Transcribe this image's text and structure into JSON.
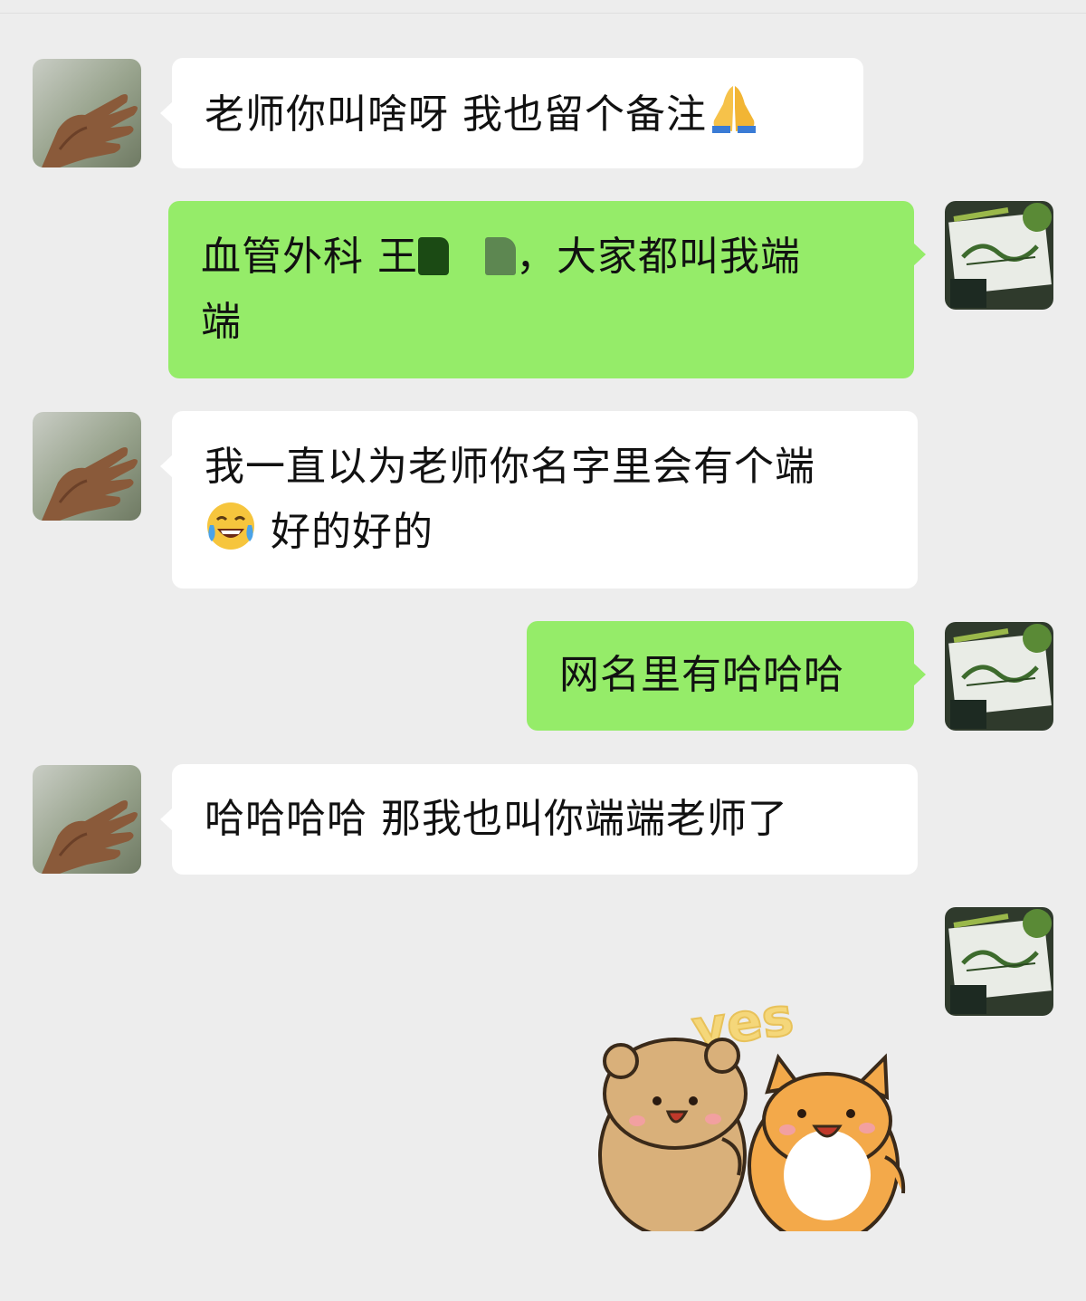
{
  "messages": [
    {
      "side": "in",
      "text_before": "老师你叫啥呀 我也留个备注",
      "emoji": "folded-hands"
    },
    {
      "side": "out",
      "line1_a": "血管外科 王",
      "line1_b": "，大家都叫我端",
      "line2": "端"
    },
    {
      "side": "in",
      "line1": "我一直以为老师你名字里会有个端",
      "emoji": "tears-of-joy",
      "line2": "好的好的"
    },
    {
      "side": "out",
      "text": "网名里有哈哈哈"
    },
    {
      "side": "in",
      "text": "哈哈哈哈 那我也叫你端端老师了"
    },
    {
      "side": "out",
      "sticker": "bear-and-fox-yes",
      "sticker_text": "yes"
    }
  ],
  "colors": {
    "background": "#ededed",
    "incoming_bubble": "#ffffff",
    "outgoing_bubble": "#95ec69",
    "text": "#111111"
  },
  "icons": {
    "contact_avatar": "hand-photo-avatar",
    "self_avatar": "calligraphy-photo-avatar"
  }
}
